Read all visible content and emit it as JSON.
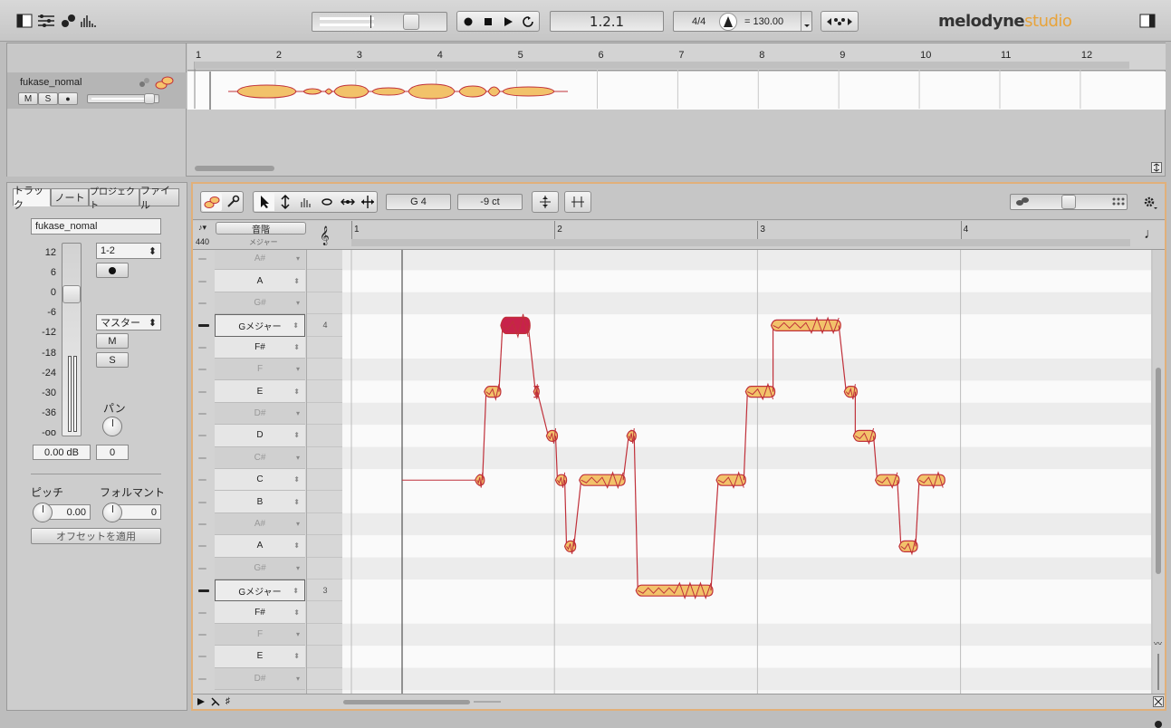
{
  "toolbar": {
    "position": "1.2.1",
    "time_signature": "4/4",
    "tempo": "= 130.00",
    "brand_main": "melodyne",
    "brand_sub": "studio"
  },
  "arrange": {
    "track_name": "fukase_nomal",
    "track_buttons": [
      "M",
      "S",
      "●"
    ],
    "bars": [
      "1",
      "2",
      "3",
      "4",
      "5",
      "6",
      "7",
      "8",
      "9",
      "10",
      "11",
      "12"
    ]
  },
  "inspector": {
    "tabs": [
      "トラック",
      "ノート",
      "プロジェクト",
      "ファイル"
    ],
    "track_name": "fukase_nomal",
    "meter_scale": [
      "12",
      "6",
      "0",
      "-6",
      "-12",
      "-18",
      "-24",
      "-30",
      "-36",
      "-oo"
    ],
    "output": "1-2",
    "master": "マスター",
    "m_label": "M",
    "s_label": "S",
    "pan_label": "パン",
    "gain": "0.00 dB",
    "pan": "0",
    "pitch_label": "ピッチ",
    "formant_label": "フォルマント",
    "pitch_value": "0.00",
    "formant_value": "0",
    "apply_offset": "オフセットを適用"
  },
  "editor": {
    "note_name": "G 4",
    "cents": "-9 ct",
    "scale_header": "音階",
    "scale_sub": "メジャー",
    "ref_pitch": "440",
    "bars": [
      "1",
      "2",
      "3",
      "4"
    ],
    "keys": [
      {
        "name": "A#",
        "black": true
      },
      {
        "name": "A",
        "black": false
      },
      {
        "name": "G#",
        "black": true
      },
      {
        "name": "Gメジャー",
        "black": false,
        "root": true,
        "octave": "4"
      },
      {
        "name": "F#",
        "black": false
      },
      {
        "name": "F",
        "black": true
      },
      {
        "name": "E",
        "black": false
      },
      {
        "name": "D#",
        "black": true
      },
      {
        "name": "D",
        "black": false
      },
      {
        "name": "C#",
        "black": true
      },
      {
        "name": "C",
        "black": false
      },
      {
        "name": "B",
        "black": false
      },
      {
        "name": "A#",
        "black": true
      },
      {
        "name": "A",
        "black": false
      },
      {
        "name": "G#",
        "black": true
      },
      {
        "name": "Gメジャー",
        "black": false,
        "root": true,
        "octave": "3"
      },
      {
        "name": "F#",
        "black": false
      },
      {
        "name": "F",
        "black": true
      },
      {
        "name": "E",
        "black": false
      },
      {
        "name": "D#",
        "black": true
      }
    ],
    "blobs": [
      {
        "row": 10,
        "x0": 0.38,
        "x1": 0.43,
        "selected": false
      },
      {
        "row": 6,
        "x0": 0.43,
        "x1": 0.52,
        "selected": false
      },
      {
        "row": 3,
        "x0": 0.52,
        "x1": 0.68,
        "selected": true
      },
      {
        "row": 6,
        "x0": 0.7,
        "x1": 0.73,
        "selected": false
      },
      {
        "row": 8,
        "x0": 0.77,
        "x1": 0.83,
        "selected": false
      },
      {
        "row": 10,
        "x0": 0.82,
        "x1": 0.88,
        "selected": false
      },
      {
        "row": 13,
        "x0": 0.87,
        "x1": 0.93,
        "selected": false
      },
      {
        "row": 10,
        "x0": 0.95,
        "x1": 1.2,
        "selected": false
      },
      {
        "row": 8,
        "x0": 1.21,
        "x1": 1.26,
        "selected": false
      },
      {
        "row": 15,
        "x0": 1.26,
        "x1": 1.68,
        "selected": false
      },
      {
        "row": 10,
        "x0": 1.7,
        "x1": 1.86,
        "selected": false
      },
      {
        "row": 6,
        "x0": 1.86,
        "x1": 2.02,
        "selected": false
      },
      {
        "row": 3,
        "x0": 2.0,
        "x1": 2.38,
        "selected": false
      },
      {
        "row": 6,
        "x0": 2.4,
        "x1": 2.47,
        "selected": false
      },
      {
        "row": 8,
        "x0": 2.45,
        "x1": 2.57,
        "selected": false
      },
      {
        "row": 10,
        "x0": 2.57,
        "x1": 2.7,
        "selected": false
      },
      {
        "row": 13,
        "x0": 2.7,
        "x1": 2.8,
        "selected": false
      },
      {
        "row": 10,
        "x0": 2.8,
        "x1": 2.95,
        "selected": false
      }
    ]
  },
  "colors": {
    "blob_fill": "#f2c26a",
    "blob_edge": "#c0303a",
    "blob_selected": "#c8224a",
    "accent_border": "#e1b07a"
  }
}
